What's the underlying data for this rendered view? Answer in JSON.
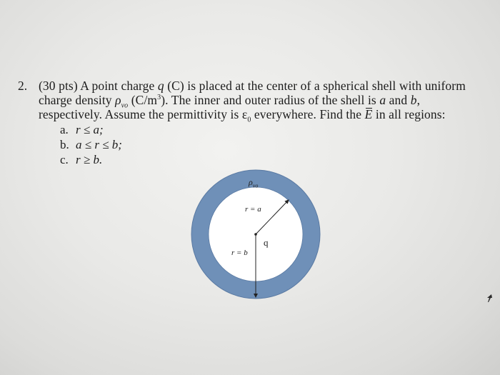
{
  "problem": {
    "number": "2.",
    "line1": {
      "points": "(30 pts)",
      "text_a": " A point charge ",
      "var_q": "q",
      "text_b": " (C) is placed at the center of a spherical shell with uniform"
    },
    "line2": {
      "text_a": "charge density ",
      "rho": "ρ",
      "rho_sub": "vo",
      "unit_a": " (C/m",
      "unit_sup": "3",
      "unit_b": "). The inner and outer radius of the shell is ",
      "var_a": "a",
      "and": " and ",
      "var_b": "b",
      "comma": ","
    },
    "line3": {
      "text_a": "respectively. Assume the permittivity is ε",
      "eps_sub": "0",
      "text_b": " everywhere. Find the ",
      "E": "E",
      "text_c": " in all regions:"
    },
    "parts": [
      {
        "letter": "a.",
        "expr": "r ≤ a;"
      },
      {
        "letter": "b.",
        "expr": "a ≤ r ≤ b;"
      },
      {
        "letter": "c.",
        "expr": "r ≥ b."
      }
    ]
  },
  "diagram": {
    "shell_label": "ρ",
    "shell_label_sub": "vo",
    "inner_label": "r = a",
    "outer_label": "r = b",
    "charge_label": "q",
    "colors": {
      "shell_fill": "#6f90b8",
      "shell_edge": "#5a7aa3",
      "inner_fill": "#ffffff",
      "line": "#222222"
    }
  }
}
